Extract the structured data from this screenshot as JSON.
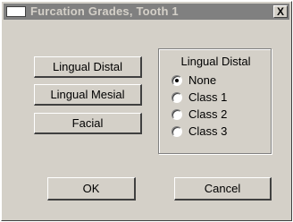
{
  "window": {
    "title": "Furcation Grades, Tooth 1",
    "close_label": "X"
  },
  "surface_buttons": {
    "lingual_distal": "Lingual Distal",
    "lingual_mesial": "Lingual Mesial",
    "facial": "Facial"
  },
  "grade_group": {
    "title": "Lingual Distal",
    "selected": "None",
    "options": [
      "None",
      "Class 1",
      "Class 2",
      "Class 3"
    ]
  },
  "footer": {
    "ok_label": "OK",
    "cancel_label": "Cancel"
  }
}
